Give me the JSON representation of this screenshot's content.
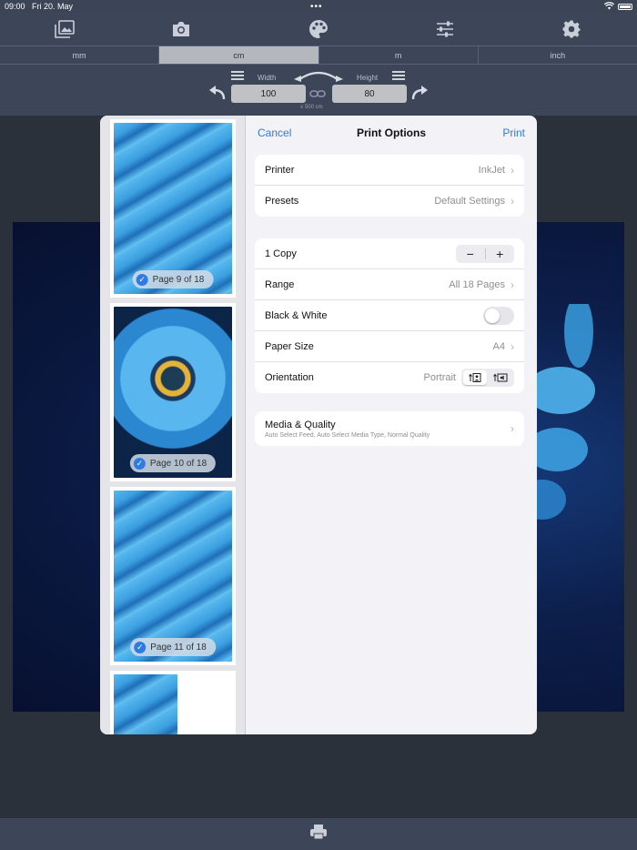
{
  "status": {
    "time": "09:00",
    "date": "Fri 20. May",
    "dots": "•••"
  },
  "toolbar": {
    "icons": [
      "gallery-icon",
      "camera-icon",
      "palette-icon",
      "sliders-icon",
      "gear-icon"
    ]
  },
  "units": [
    "mm",
    "cm",
    "m",
    "inch"
  ],
  "active_unit": "cm",
  "size": {
    "width_label": "Width",
    "height_label": "Height",
    "width_value": "100",
    "height_value": "80",
    "note": "≤ 500 cm"
  },
  "dialog": {
    "cancel": "Cancel",
    "title": "Print Options",
    "print": "Print",
    "printer_label": "Printer",
    "printer_value": "InkJet",
    "presets_label": "Presets",
    "presets_value": "Default Settings",
    "copies_label": "1 Copy",
    "minus": "−",
    "plus": "+",
    "range_label": "Range",
    "range_value": "All 18 Pages",
    "bw_label": "Black & White",
    "paper_label": "Paper Size",
    "paper_value": "A4",
    "orientation_label": "Orientation",
    "orientation_value": "Portrait",
    "media_title": "Media & Quality",
    "media_sub": "Auto Select Feed, Auto Select Media Type, Normal Quality"
  },
  "previews": [
    {
      "label": "Page 9 of 18"
    },
    {
      "label": "Page 10 of 18"
    },
    {
      "label": "Page 11 of 18"
    }
  ],
  "colors": {
    "accent": "#2f7be5",
    "toolbar": "#3d4658"
  }
}
